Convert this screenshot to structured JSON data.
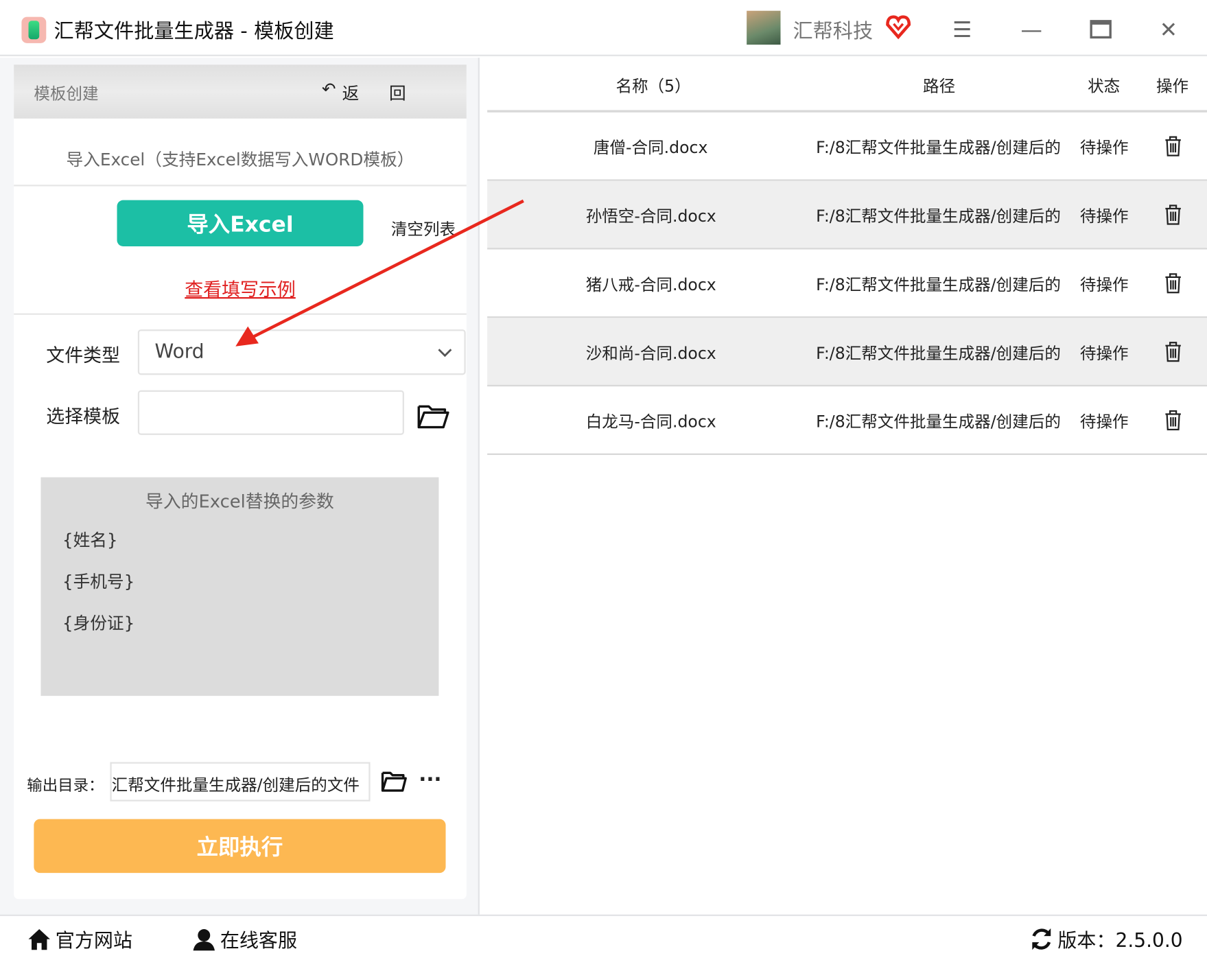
{
  "window": {
    "title": "汇帮文件批量生成器 - 模板创建",
    "brand": "汇帮科技",
    "controls": [
      "menu",
      "minimize",
      "maximize",
      "close"
    ]
  },
  "left": {
    "header_title": "模板创建",
    "back_label": "返 回",
    "import_hint": "导入Excel（支持Excel数据写入WORD模板）",
    "import_button": "导入Excel",
    "clear_list": "清空列表",
    "example_link": "查看填写示例",
    "file_type_label": "文件类型",
    "file_type_value": "Word",
    "template_label": "选择模板",
    "template_value": "",
    "params_title": "导入的Excel替换的参数",
    "params": [
      "{姓名}",
      "{手机号}",
      "{身份证}"
    ],
    "output_label": "输出目录：",
    "output_value": "汇帮文件批量生成器/创建后的文件",
    "execute_button": "立即执行"
  },
  "table": {
    "headers": {
      "name": "名称（5）",
      "path": "路径",
      "status": "状态",
      "action": "操作"
    },
    "rows": [
      {
        "name": "唐僧-合同.docx",
        "path": "F:/8汇帮文件批量生成器/创建后的",
        "status": "待操作"
      },
      {
        "name": "孙悟空-合同.docx",
        "path": "F:/8汇帮文件批量生成器/创建后的",
        "status": "待操作"
      },
      {
        "name": "猪八戒-合同.docx",
        "path": "F:/8汇帮文件批量生成器/创建后的",
        "status": "待操作"
      },
      {
        "name": "沙和尚-合同.docx",
        "path": "F:/8汇帮文件批量生成器/创建后的",
        "status": "待操作"
      },
      {
        "name": "白龙马-合同.docx",
        "path": "F:/8汇帮文件批量生成器/创建后的",
        "status": "待操作"
      }
    ]
  },
  "footer": {
    "website": "官方网站",
    "support": "在线客服",
    "version": "版本：2.5.0.0"
  },
  "colors": {
    "teal": "#1cbfa5",
    "orange": "#fdb852",
    "link_red": "#e02020",
    "arrow_red": "#e8281e"
  }
}
